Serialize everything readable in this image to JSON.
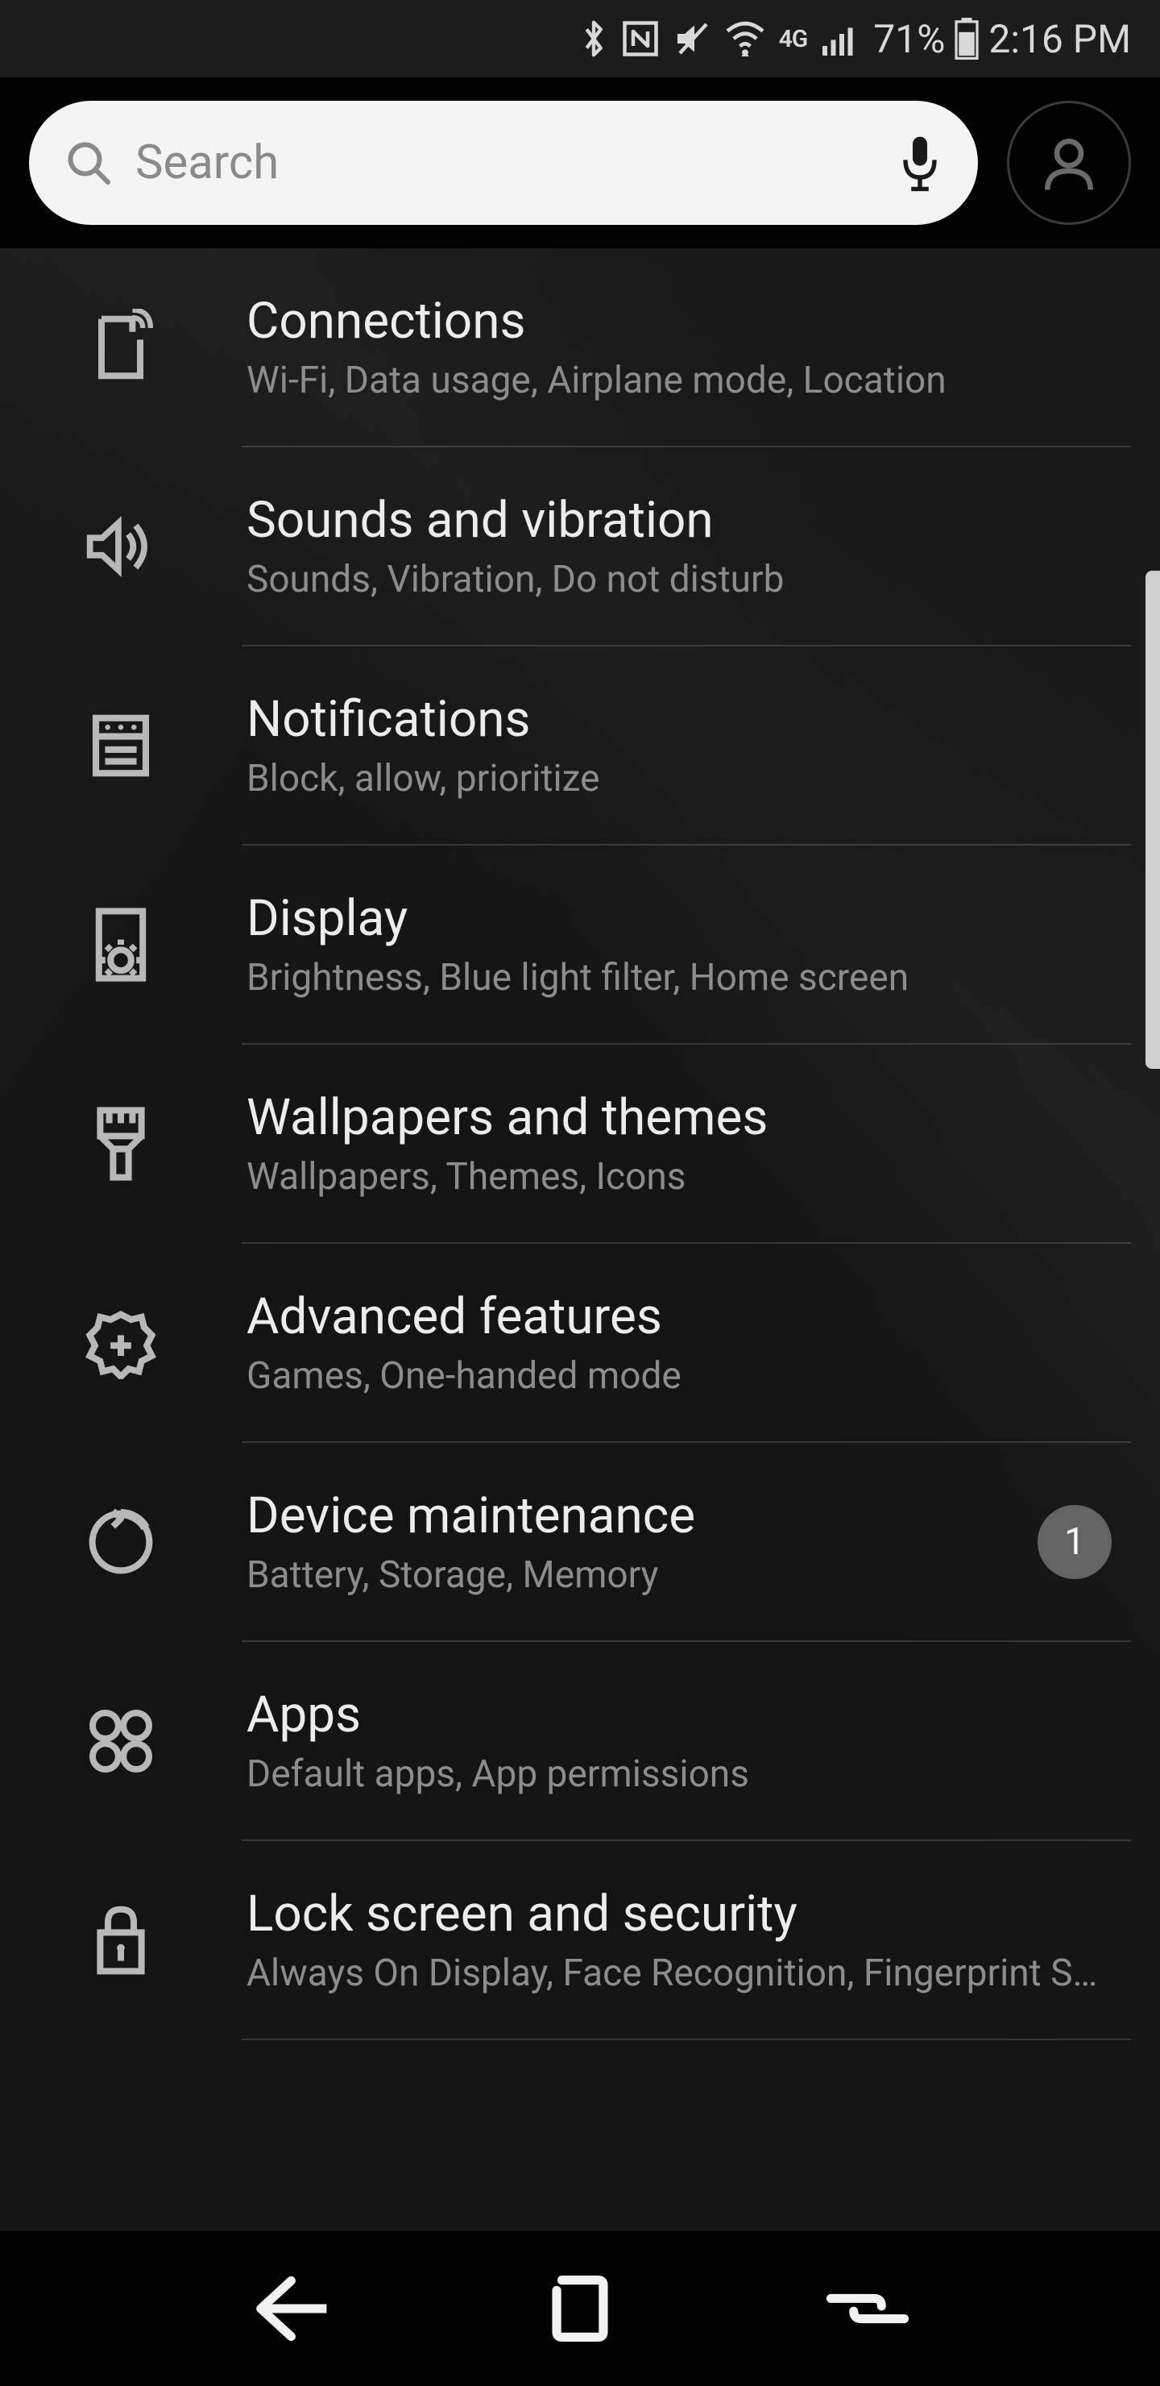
{
  "status": {
    "network_label": "4G",
    "battery_pct": "71%",
    "time": "2:16 PM"
  },
  "search": {
    "placeholder": "Search"
  },
  "items": [
    {
      "title": "Connections",
      "sub": "Wi-Fi, Data usage, Airplane mode, Location"
    },
    {
      "title": "Sounds and vibration",
      "sub": "Sounds, Vibration, Do not disturb"
    },
    {
      "title": "Notifications",
      "sub": "Block, allow, prioritize"
    },
    {
      "title": "Display",
      "sub": "Brightness, Blue light filter, Home screen"
    },
    {
      "title": "Wallpapers and themes",
      "sub": "Wallpapers, Themes, Icons"
    },
    {
      "title": "Advanced features",
      "sub": "Games, One-handed mode"
    },
    {
      "title": "Device maintenance",
      "sub": "Battery, Storage, Memory",
      "badge": "1"
    },
    {
      "title": "Apps",
      "sub": "Default apps, App permissions"
    },
    {
      "title": "Lock screen and security",
      "sub": "Always On Display, Face Recognition, Fingerprint Scanner"
    }
  ]
}
